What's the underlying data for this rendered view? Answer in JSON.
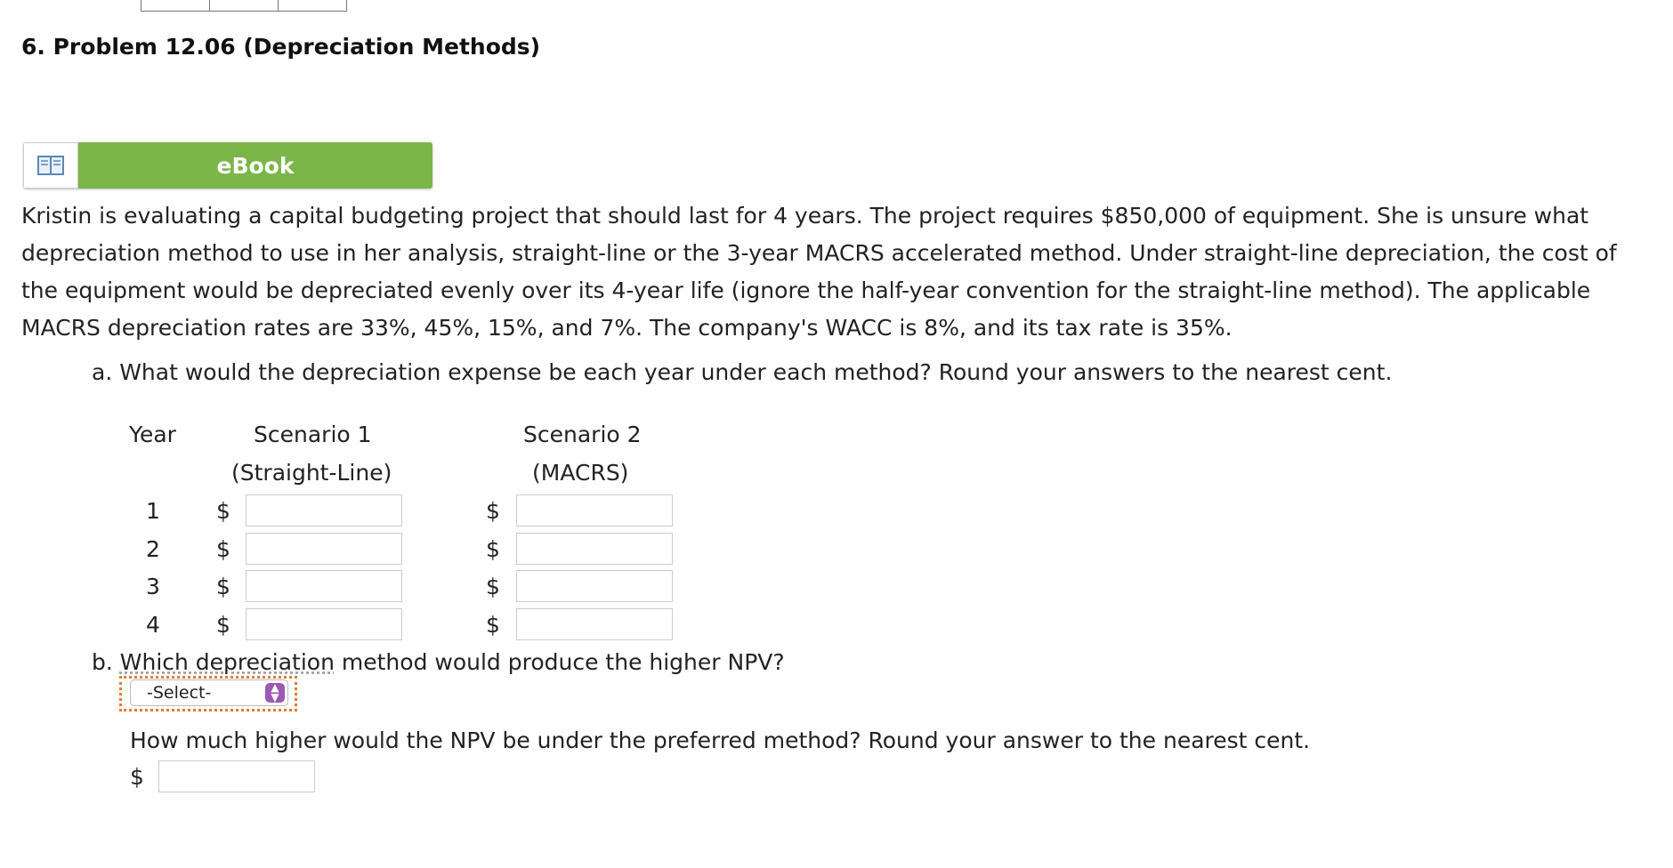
{
  "problem": {
    "title": "6. Problem 12.06 (Depreciation Methods)"
  },
  "ebook": {
    "label": "eBook"
  },
  "intro": "Kristin is evaluating a capital budgeting project that should last for 4 years. The project requires $850,000 of equipment. She is unsure what depreciation method to use in her analysis, straight-line or the 3-year MACRS accelerated method. Under straight-line depreciation, the cost of the equipment would be depreciated evenly over its 4-year life (ignore the half-year convention for the straight-line method). The applicable MACRS depreciation rates are 33%, 45%, 15%, and 7%. The company's WACC is 8%, and its tax rate is 35%.",
  "part_a": {
    "question": "a. What would the depreciation expense be each year under each method? Round your answers to the nearest cent.",
    "col_year": "Year",
    "col_s1_line1": "Scenario 1",
    "col_s1_line2": "(Straight-Line)",
    "col_s2_line1": "Scenario 2",
    "col_s2_line2": "(MACRS)",
    "currency": "$",
    "rows": [
      {
        "year": "1",
        "s1": "",
        "s2": ""
      },
      {
        "year": "2",
        "s1": "",
        "s2": ""
      },
      {
        "year": "3",
        "s1": "",
        "s2": ""
      },
      {
        "year": "4",
        "s1": "",
        "s2": ""
      }
    ]
  },
  "part_b": {
    "question_prefix": "b. ",
    "question_underlined": "Which depreciation",
    "question_rest": " method would produce the higher NPV?",
    "select_value": "-Select-",
    "followup": "How much higher would the NPV be under the preferred method? Round your answer to the nearest cent.",
    "currency": "$",
    "answer": ""
  },
  "colors": {
    "ebook_green": "#7ab648",
    "select_focus": "#e87a2d",
    "select_arrow": "#9b59b6"
  }
}
